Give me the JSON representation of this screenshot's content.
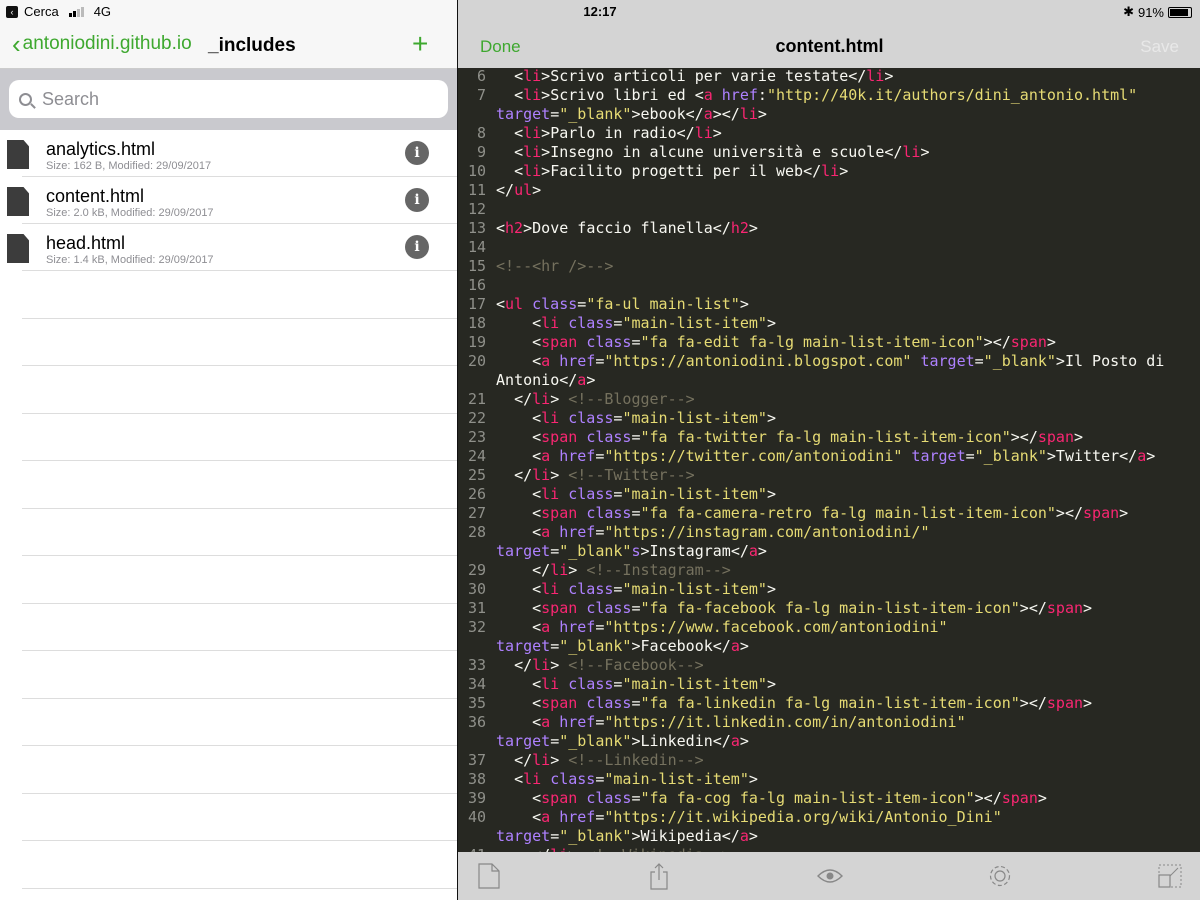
{
  "status_bar": {
    "back_app": "Cerca",
    "network": "4G",
    "time": "12:17",
    "battery": "91%",
    "battery_level": 0.91
  },
  "sidebar": {
    "back_label": "antoniodini.github.io",
    "folder_title": "_includes",
    "add_label": "+",
    "search_placeholder": "Search",
    "files": [
      {
        "name": "analytics.html",
        "meta": "Size: 162 B, Modified: 29/09/2017"
      },
      {
        "name": "content.html",
        "meta": "Size: 2.0 kB, Modified: 29/09/2017"
      },
      {
        "name": "head.html",
        "meta": "Size: 1.4 kB, Modified: 29/09/2017"
      }
    ],
    "info_glyph": "i"
  },
  "editor": {
    "done_label": "Done",
    "title": "content.html",
    "save_label": "Save",
    "lines": [
      {
        "n": "6",
        "text": "  <li>Scrivo articoli per varie testate</li>"
      },
      {
        "n": "7",
        "text": "  <li>Scrivo libri ed <a href:\"http://40k.it/authors/dini_antonio.html\" target=\"_blank\">ebook</a></li>"
      },
      {
        "n": "8",
        "text": "  <li>Parlo in radio</li>"
      },
      {
        "n": "9",
        "text": "  <li>Insegno in alcune università e scuole</li>"
      },
      {
        "n": "10",
        "text": "  <li>Facilito progetti per il web</li>"
      },
      {
        "n": "11",
        "text": "</ul>"
      },
      {
        "n": "12",
        "text": ""
      },
      {
        "n": "13",
        "text": "<h2>Dove faccio flanella</h2>"
      },
      {
        "n": "14",
        "text": ""
      },
      {
        "n": "15",
        "text": "<!--<hr />-->"
      },
      {
        "n": "16",
        "text": ""
      },
      {
        "n": "17",
        "text": "<ul class=\"fa-ul main-list\">"
      },
      {
        "n": "18",
        "text": "    <li class=\"main-list-item\">"
      },
      {
        "n": "19",
        "text": "    <span class=\"fa fa-edit fa-lg main-list-item-icon\"></span>"
      },
      {
        "n": "20",
        "text": "    <a href=\"https://antoniodini.blogspot.com\" target=\"_blank\">Il Posto di Antonio</a>"
      },
      {
        "n": "21",
        "text": "  </li> <!--Blogger-->"
      },
      {
        "n": "22",
        "text": "    <li class=\"main-list-item\">"
      },
      {
        "n": "23",
        "text": "    <span class=\"fa fa-twitter fa-lg main-list-item-icon\"></span>"
      },
      {
        "n": "24",
        "text": "    <a href=\"https://twitter.com/antoniodini\" target=\"_blank\">Twitter</a>"
      },
      {
        "n": "25",
        "text": "  </li> <!--Twitter-->"
      },
      {
        "n": "26",
        "text": "    <li class=\"main-list-item\">"
      },
      {
        "n": "27",
        "text": "    <span class=\"fa fa-camera-retro fa-lg main-list-item-icon\"></span>"
      },
      {
        "n": "28",
        "text": "    <a href=\"https://instagram.com/antoniodini/\" target=\"_blank\"s>Instagram</a>"
      },
      {
        "n": "29",
        "text": "    </li> <!--Instagram-->"
      },
      {
        "n": "30",
        "text": "    <li class=\"main-list-item\">"
      },
      {
        "n": "31",
        "text": "    <span class=\"fa fa-facebook fa-lg main-list-item-icon\"></span>"
      },
      {
        "n": "32",
        "text": "    <a href=\"https://www.facebook.com/antoniodini\" target=\"_blank\">Facebook</a>"
      },
      {
        "n": "33",
        "text": "  </li> <!--Facebook-->"
      },
      {
        "n": "34",
        "text": "    <li class=\"main-list-item\">"
      },
      {
        "n": "35",
        "text": "    <span class=\"fa fa-linkedin fa-lg main-list-item-icon\"></span>"
      },
      {
        "n": "36",
        "text": "    <a href=\"https://it.linkedin.com/in/antoniodini\" target=\"_blank\">Linkedin</a>"
      },
      {
        "n": "37",
        "text": "  </li> <!--Linkedin-->"
      },
      {
        "n": "38",
        "text": "  <li class=\"main-list-item\">"
      },
      {
        "n": "39",
        "text": "    <span class=\"fa fa-cog fa-lg main-list-item-icon\"></span>"
      },
      {
        "n": "40",
        "text": "    <a href=\"https://it.wikipedia.org/wiki/Antonio_Dini\" target=\"_blank\">Wikipedia</a>"
      },
      {
        "n": "41",
        "text": "    </li> <!--Wikipedia-->"
      }
    ],
    "colors": {
      "tag": "#f92672",
      "attr": "#ae81ff",
      "string": "#e6db74",
      "comment": "#75715e",
      "background": "#272822"
    }
  },
  "toolbar": {
    "icons": [
      "new-file-icon",
      "share-icon",
      "preview-eye-icon",
      "settings-gear-icon",
      "fullscreen-icon"
    ]
  }
}
